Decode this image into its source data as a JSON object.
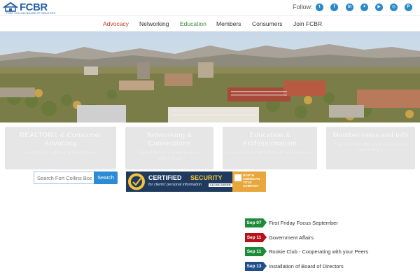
{
  "header": {
    "logo_text": "FCBR",
    "logo_sub": "FORT COLLINS BOARD OF REALTORS",
    "follow_label": "Follow:",
    "social": [
      {
        "icon": "twitter-icon",
        "glyph": "t"
      },
      {
        "icon": "facebook-icon",
        "glyph": "f"
      },
      {
        "icon": "linkedin-icon",
        "glyph": "in"
      },
      {
        "icon": "instagram-alt-icon",
        "glyph": "✦"
      },
      {
        "icon": "youtube-icon",
        "glyph": "▶"
      },
      {
        "icon": "instagram-icon",
        "glyph": "◎"
      },
      {
        "icon": "pinterest-icon",
        "glyph": "P"
      }
    ]
  },
  "nav": {
    "items": [
      {
        "label": "Advocacy",
        "color": "#c0392b"
      },
      {
        "label": "Networking",
        "color": "#333333"
      },
      {
        "label": "Education",
        "color": "#3d8b3d"
      },
      {
        "label": "Members",
        "color": "#333333"
      },
      {
        "label": "Consumers",
        "color": "#333333"
      },
      {
        "label": "Join FCBR",
        "color": "#333333"
      }
    ]
  },
  "features": [
    {
      "title": "REALTOR® & Consumer Advocacy",
      "sub": "Protecting the rights of property owners"
    },
    {
      "title": "Networking & Connections",
      "sub": "Opportunities to build business relationships"
    },
    {
      "title": "Education & Professionalism",
      "sub": "Classes and events for continued success"
    },
    {
      "title": "Member news and info",
      "sub": "Stay informed about your association and industry"
    }
  ],
  "search": {
    "placeholder": "Search Fort Collins Board",
    "button_label": "Search"
  },
  "cert": {
    "main": "CERTIFIED",
    "sub": "SECURITY",
    "line2": "for clients' personal information",
    "learn": "LEARN MORE",
    "company": "NORTH AMERICAN TITLE COMPANY"
  },
  "events": [
    {
      "date": "Sep 07",
      "title": "First Friday Focus September",
      "color": "#1d8a3a"
    },
    {
      "date": "Sep 11",
      "title": "Government Affairs",
      "color": "#b5121b"
    },
    {
      "date": "Sep 11",
      "title": "Rookie Club - Cooperating with your Peers",
      "color": "#1d8a3a"
    },
    {
      "date": "Sep 13",
      "title": "Installation of Board of Directors",
      "color": "#1f4f8b"
    }
  ]
}
